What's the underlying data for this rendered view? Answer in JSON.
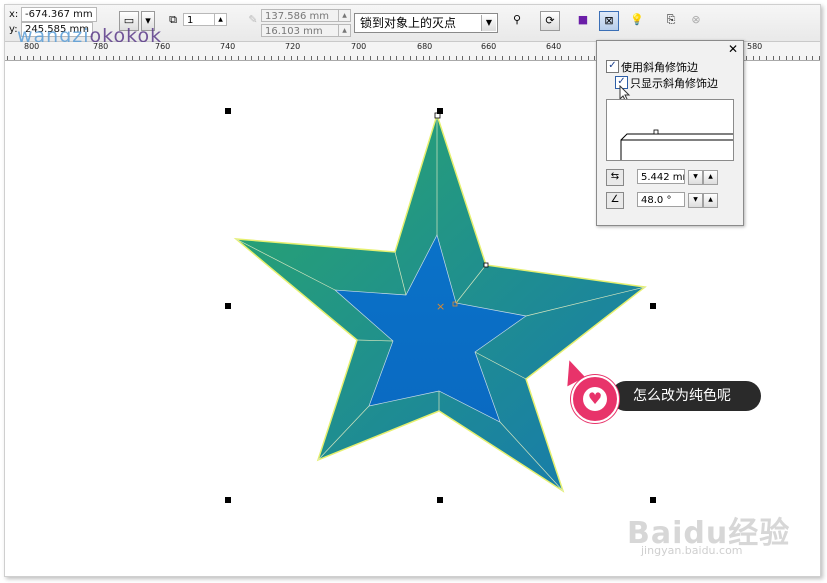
{
  "toolbar": {
    "x_label": "x:",
    "x_value": "-674.367 mm",
    "y_label": "y:",
    "y_value": "245.585 mm",
    "count_value": "1",
    "width_value": "137.586 mm",
    "height_value": "16.103 mm",
    "snap_mode": "锁到对象上的灭点"
  },
  "watermark": {
    "text_a": "wangzi",
    "text_b": "okokok"
  },
  "ruler": {
    "ticks": [
      "800",
      "780",
      "760",
      "740",
      "720",
      "700",
      "680",
      "660",
      "640",
      "580"
    ]
  },
  "bevel_panel": {
    "use_bevel_label": "使用斜角修饰边",
    "use_bevel_checked": true,
    "show_only_bevel_label": "只显示斜角修饰边",
    "show_only_bevel_checked": true,
    "depth_value": "5.442 mr",
    "angle_value": "48.0 °"
  },
  "callout": {
    "text": "怎么改为纯色呢"
  },
  "baidu_watermark": {
    "logo": "Baidu经验",
    "url": "jingyan.baidu.com"
  },
  "colors": {
    "star_outer": "#1f9a6c",
    "star_inner": "#0b6fc6",
    "callout_accent": "#e8336a"
  }
}
